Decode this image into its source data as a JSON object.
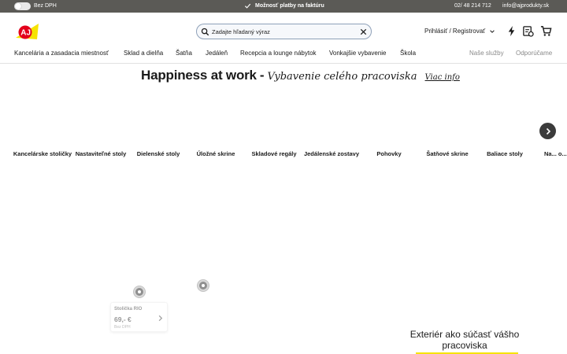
{
  "topbar": {
    "vat_toggle_label": "Bez DPH",
    "payment_notice": "Možnosť platby na faktúru",
    "phone": "02/ 48 214 712",
    "email": "info@ajprodukty.sk"
  },
  "header": {
    "search_placeholder": "Zadajte hľadaný výraz",
    "login_label": "Prihlásiť / Registrovať"
  },
  "nav": {
    "items": [
      "Kancelária a zasadacia miestnosť",
      "Sklad a dielňa",
      "Šatňa",
      "Jedáleň",
      "Recepcia a lounge nábytok",
      "Vonkajšie vybavenie",
      "Škola"
    ],
    "secondary": [
      "Naše služby",
      "Odporúčame"
    ]
  },
  "hero": {
    "title": "Happiness at work",
    "dash": "-",
    "subtitle": "Vybavenie celého pracoviska",
    "more_link": "Viac info"
  },
  "categories": [
    "Kancelárske stoličky",
    "Nastaviteľné stoly",
    "Dielenské stoly",
    "Úložné skrine",
    "Skladové regály",
    "Jedálenské zostavy",
    "Pohovky",
    "Šatňové skrine",
    "Baliace stoly",
    "Na... o..."
  ],
  "product_card": {
    "name": "Stolička RIO",
    "price": "69,- €",
    "vat_note": "Bez DPH"
  },
  "promo": {
    "text": "Exteriér ako súčasť vášho pracoviska"
  },
  "colors": {
    "topbar_bg": "#5b5a56",
    "brand_red": "#e3001b",
    "brand_yellow": "#f6e300",
    "search_border": "#8ea0b8"
  },
  "icons": [
    "check-icon",
    "logo",
    "search-icon",
    "clear-icon",
    "chevron-down-icon",
    "lightning-icon",
    "quote-icon",
    "cart-icon",
    "next-arrow-icon"
  ]
}
